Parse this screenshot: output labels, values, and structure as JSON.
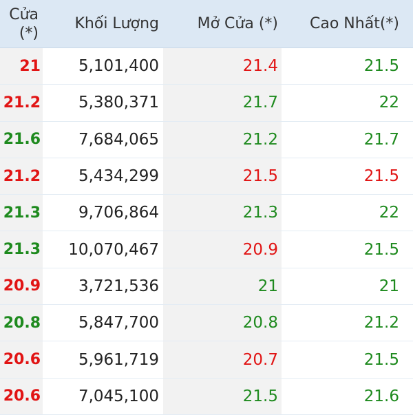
{
  "headers": {
    "close_line1": "Cửa",
    "close_line2": "(*)",
    "volume": "Khối Lượng",
    "open": "Mở Cửa (*)",
    "high": "Cao Nhất(*)"
  },
  "colors": {
    "up": "#1e8a1e",
    "down": "#e11414",
    "header_bg": "#dce8f4",
    "shaded_col": "#f2f2f2"
  },
  "rows": [
    {
      "close": "21",
      "close_color": "down",
      "volume": "5,101,400",
      "open": "21.4",
      "open_color": "down",
      "high": "21.5",
      "high_color": "up"
    },
    {
      "close": "21.2",
      "close_color": "down",
      "volume": "5,380,371",
      "open": "21.7",
      "open_color": "up",
      "high": "22",
      "high_color": "up"
    },
    {
      "close": "21.6",
      "close_color": "up",
      "volume": "7,684,065",
      "open": "21.2",
      "open_color": "up",
      "high": "21.7",
      "high_color": "up"
    },
    {
      "close": "21.2",
      "close_color": "down",
      "volume": "5,434,299",
      "open": "21.5",
      "open_color": "down",
      "high": "21.5",
      "high_color": "down"
    },
    {
      "close": "21.3",
      "close_color": "up",
      "volume": "9,706,864",
      "open": "21.3",
      "open_color": "up",
      "high": "22",
      "high_color": "up"
    },
    {
      "close": "21.3",
      "close_color": "up",
      "volume": "10,070,467",
      "open": "20.9",
      "open_color": "down",
      "high": "21.5",
      "high_color": "up"
    },
    {
      "close": "20.9",
      "close_color": "down",
      "volume": "3,721,536",
      "open": "21",
      "open_color": "up",
      "high": "21",
      "high_color": "up"
    },
    {
      "close": "20.8",
      "close_color": "up",
      "volume": "5,847,700",
      "open": "20.8",
      "open_color": "up",
      "high": "21.2",
      "high_color": "up"
    },
    {
      "close": "20.6",
      "close_color": "down",
      "volume": "5,961,719",
      "open": "20.7",
      "open_color": "down",
      "high": "21.5",
      "high_color": "up"
    },
    {
      "close": "20.6",
      "close_color": "down",
      "volume": "7,045,100",
      "open": "21.5",
      "open_color": "up",
      "high": "21.6",
      "high_color": "up"
    }
  ]
}
